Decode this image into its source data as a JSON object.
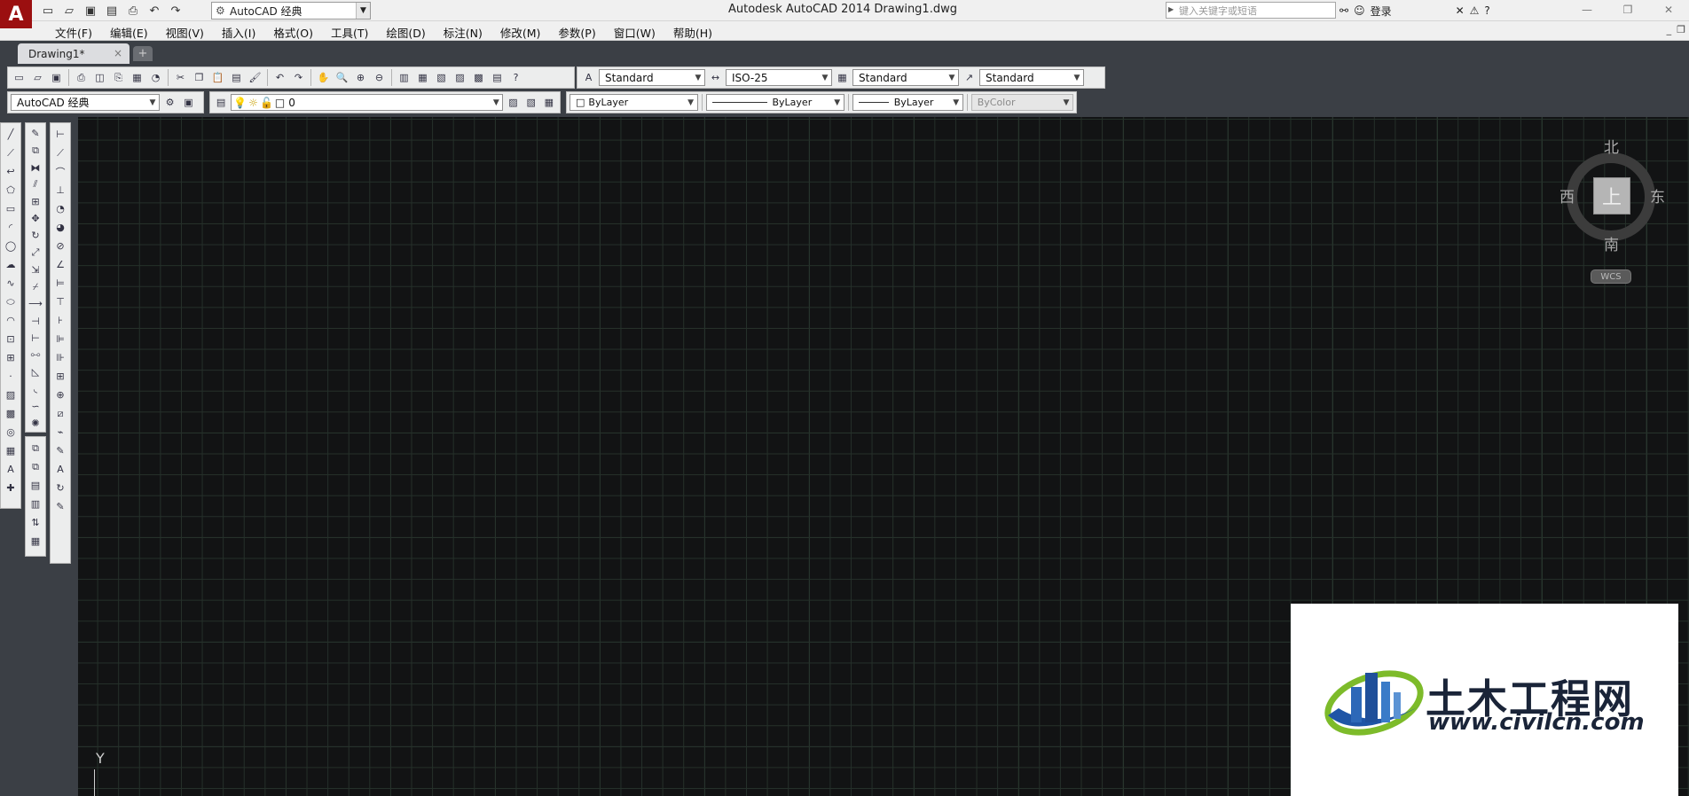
{
  "app": {
    "logo": "A",
    "window_title": "Autodesk AutoCAD 2014    Drawing1.dwg",
    "workspace": "AutoCAD 经典",
    "search_placeholder": "键入关键字或短语",
    "login": "登录"
  },
  "menu": [
    "文件(F)",
    "编辑(E)",
    "视图(V)",
    "插入(I)",
    "格式(O)",
    "工具(T)",
    "绘图(D)",
    "标注(N)",
    "修改(M)",
    "参数(P)",
    "窗口(W)",
    "帮助(H)"
  ],
  "tabs": {
    "active": "Drawing1*",
    "close": "×",
    "new": "+"
  },
  "styles_toolbar": {
    "text_style": "Standard",
    "dim_style": "ISO-25",
    "table_style": "Standard",
    "mleader_style": "Standard"
  },
  "workspace_toolbar": {
    "workspace": "AutoCAD 经典"
  },
  "layers_toolbar": {
    "current_layer": "0"
  },
  "properties_toolbar": {
    "color": "ByLayer",
    "linetype": "ByLayer",
    "lineweight": "ByLayer",
    "plotstyle": "ByColor"
  },
  "viewcube": {
    "north": "北",
    "south": "南",
    "east": "东",
    "west": "西",
    "top": "上",
    "wcs": "WCS"
  },
  "ucs": {
    "y_label": "Y"
  },
  "watermark": {
    "brand": "土木工程网",
    "url": "www.civilcn.com"
  }
}
